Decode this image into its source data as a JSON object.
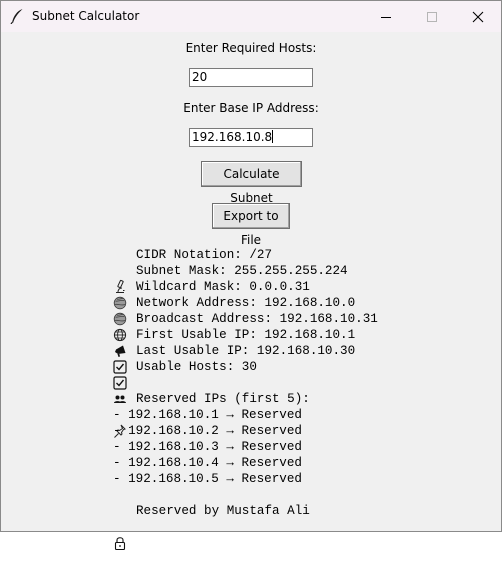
{
  "window": {
    "title": "Subnet Calculator"
  },
  "form": {
    "hosts_label": "Enter Required Hosts:",
    "hosts_value": "20",
    "ip_label": "Enter Base IP Address:",
    "ip_value": "192.168.10.8",
    "calculate_label": "Calculate Subnet",
    "export_label": "Export to File"
  },
  "results": {
    "cidr": {
      "icon": "microscope-icon",
      "text": "CIDR Notation: /27"
    },
    "mask": {
      "icon": "globe-icon",
      "text": "Subnet Mask: 255.255.255.224"
    },
    "wildcard": {
      "icon": "globe-icon",
      "text": "Wildcard Mask: 0.0.0.31"
    },
    "network": {
      "icon": "globe-meridians-icon",
      "text": "Network Address: 192.168.10.0"
    },
    "broadcast": {
      "icon": "megaphone-icon",
      "text": "Broadcast Address: 192.168.10.31"
    },
    "first_usable": {
      "icon": "checkbox-icon",
      "text": "First Usable IP: 192.168.10.1"
    },
    "last_usable": {
      "icon": "checkbox-icon",
      "text": "Last Usable IP: 192.168.10.30"
    },
    "usable_hosts": {
      "icon": "people-icon",
      "text": "Usable Hosts: 30"
    },
    "reserved_header": {
      "icon": "pushpin-icon",
      "text": "Reserved IPs (first 5):"
    },
    "reserved": [
      "- 192.168.10.1 → Reserved",
      "- 192.168.10.2 → Reserved",
      "- 192.168.10.3 → Reserved",
      "- 192.168.10.4 → Reserved",
      "- 192.168.10.5 → Reserved"
    ],
    "footer": {
      "icon": "lock-icon",
      "text": "Reserved by Mustafa Ali"
    }
  }
}
